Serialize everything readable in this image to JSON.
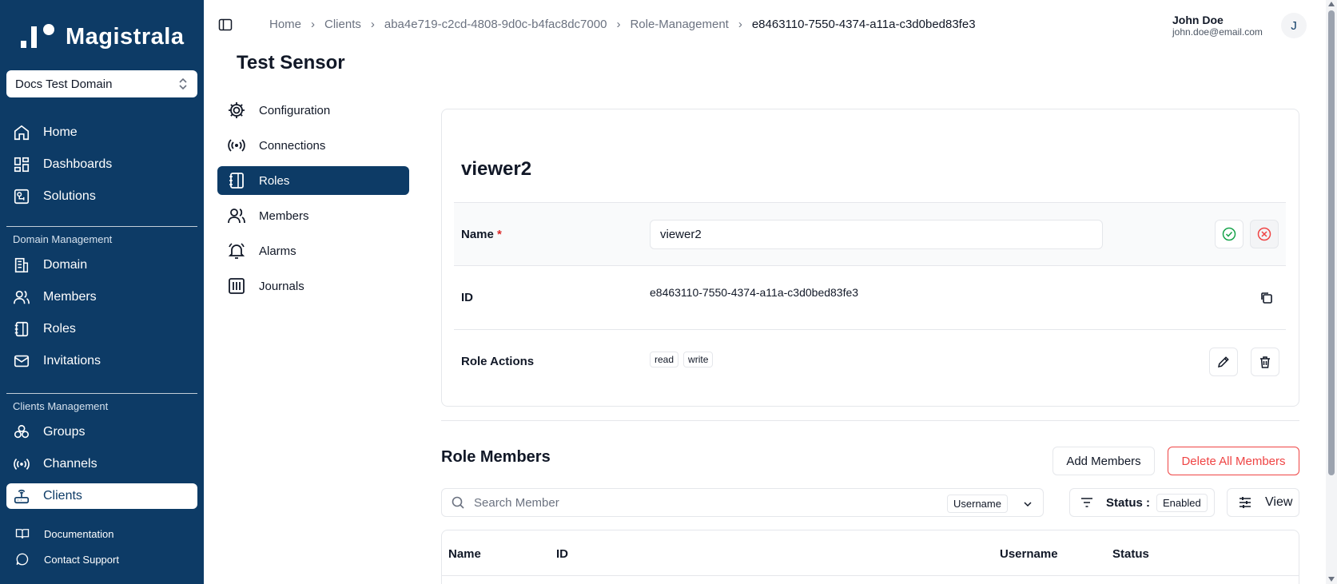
{
  "sidebar": {
    "brand": "Magistrala",
    "domain_select": "Docs Test Domain",
    "items": [
      {
        "label": "Home",
        "icon": "home-icon"
      },
      {
        "label": "Dashboards",
        "icon": "dashboard-icon"
      },
      {
        "label": "Solutions",
        "icon": "solutions-icon"
      }
    ],
    "domain_group": "Domain Management",
    "domain_items": [
      {
        "label": "Domain",
        "icon": "building-icon"
      },
      {
        "label": "Members",
        "icon": "users-icon"
      },
      {
        "label": "Roles",
        "icon": "notebook-icon"
      },
      {
        "label": "Invitations",
        "icon": "mail-icon"
      }
    ],
    "clients_group": "Clients Management",
    "clients_items": [
      {
        "label": "Groups",
        "icon": "groups-icon"
      },
      {
        "label": "Channels",
        "icon": "radio-icon"
      },
      {
        "label": "Clients",
        "icon": "router-icon",
        "active": true
      }
    ],
    "footer_items": [
      {
        "label": "Documentation",
        "icon": "book-icon"
      },
      {
        "label": "Contact Support",
        "icon": "chat-icon"
      }
    ]
  },
  "header": {
    "breadcrumb": [
      "Home",
      "Clients",
      "aba4e719-c2cd-4808-9d0c-b4fac8dc7000",
      "Role-Management",
      "e8463110-7550-4374-a11a-c3d0bed83fe3"
    ],
    "user_name": "John Doe",
    "user_email": "john.doe@email.com",
    "avatar_initial": "J"
  },
  "page": {
    "title": "Test Sensor",
    "subnav": [
      {
        "label": "Configuration",
        "icon": "gear-icon"
      },
      {
        "label": "Connections",
        "icon": "radio-icon"
      },
      {
        "label": "Roles",
        "icon": "notebook-icon",
        "active": true
      },
      {
        "label": "Members",
        "icon": "users-icon"
      },
      {
        "label": "Alarms",
        "icon": "bell-icon"
      },
      {
        "label": "Journals",
        "icon": "journal-icon"
      }
    ]
  },
  "role": {
    "title": "viewer2",
    "name_label": "Name",
    "name_required": "*",
    "name_value": "viewer2",
    "id_label": "ID",
    "id_value": "e8463110-7550-4374-a11a-c3d0bed83fe3",
    "actions_label": "Role Actions",
    "actions": [
      "read",
      "write"
    ]
  },
  "members": {
    "title": "Role Members",
    "add_label": "Add Members",
    "delete_all_label": "Delete All Members",
    "search_placeholder": "Search Member",
    "search_field": "Username",
    "status_label": "Status :",
    "status_value": "Enabled",
    "view_label": "View",
    "columns": [
      "Name",
      "ID",
      "Username",
      "Status"
    ]
  },
  "colors": {
    "sidebar": "#0d3b66",
    "accent": "#0d3b66",
    "danger": "#ef4444",
    "confirm": "#16a34a"
  }
}
